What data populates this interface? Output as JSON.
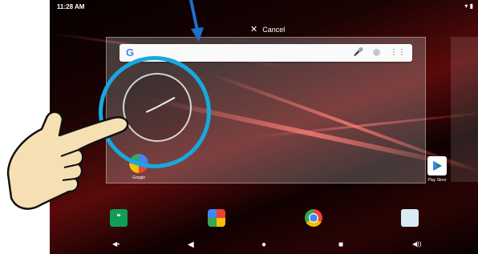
{
  "status_bar": {
    "time": "11:28 AM",
    "icons": "▾ ▮"
  },
  "cancel": {
    "icon": "close-icon",
    "label": "Cancel"
  },
  "search": {
    "logo": "G",
    "icons": [
      "mic-icon",
      "lens-icon",
      "grid-icon"
    ]
  },
  "apps": [
    {
      "label": "Google"
    },
    {
      "label": "Play Store"
    }
  ],
  "dock": [
    "hangouts-icon",
    "photos-icon",
    "chrome-icon",
    "camera-icon"
  ],
  "colors": {
    "highlight": "#18a8e0",
    "arrow": "#1d70c8",
    "hand_fill": "#f7dfb4"
  }
}
